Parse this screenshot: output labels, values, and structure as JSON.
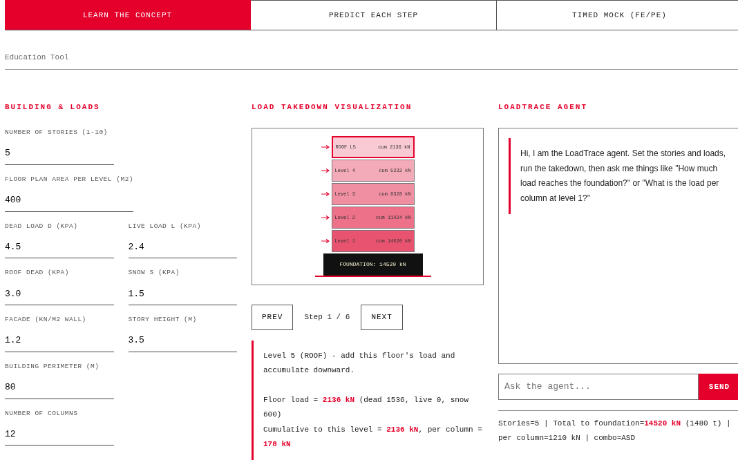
{
  "tabs": [
    {
      "label": "LEARN THE CONCEPT",
      "selected": true
    },
    {
      "label": "PREDICT EACH STEP",
      "selected": false
    },
    {
      "label": "TIMED MOCK (FE/PE)",
      "selected": false
    }
  ],
  "subtitle": "Education Tool",
  "inputs_panel": {
    "title": "BUILDING & LOADS",
    "rows": [
      [
        {
          "label": "NUMBER OF STORIES (1-10)",
          "value": "5"
        }
      ],
      [
        {
          "label": "FLOOR PLAN AREA PER LEVEL (M2)",
          "value": "400"
        }
      ],
      [
        {
          "label": "DEAD LOAD D (KPA)",
          "value": "4.5"
        },
        {
          "label": "LIVE LOAD L (KPA)",
          "value": "2.4"
        }
      ],
      [
        {
          "label": "ROOF DEAD (KPA)",
          "value": "3.0"
        },
        {
          "label": "SNOW S (KPA)",
          "value": "1.5"
        }
      ],
      [
        {
          "label": "FACADE (KN/M2 WALL)",
          "value": "1.2"
        },
        {
          "label": "STORY HEIGHT (M)",
          "value": "3.5"
        }
      ],
      [
        {
          "label": "BUILDING PERIMETER (M)",
          "value": "80"
        }
      ],
      [
        {
          "label": "NUMBER OF COLUMNS",
          "value": "12"
        }
      ]
    ]
  },
  "visualization": {
    "title": "LOAD TAKEDOWN VISUALIZATION",
    "floors": [
      {
        "name": "ROOF L5",
        "cumulative": "cum 2136 kN",
        "color": "#f9cad4",
        "selected": true
      },
      {
        "name": "Level 4",
        "cumulative": "cum 5232 kN",
        "color": "#f4abb9",
        "selected": false
      },
      {
        "name": "Level 3",
        "cumulative": "cum 8328 kN",
        "color": "#f08fa2",
        "selected": false
      },
      {
        "name": "Level 2",
        "cumulative": "cum 11424 kN",
        "color": "#ec7189",
        "selected": false
      },
      {
        "name": "Level 1",
        "cumulative": "cum 14520 kN",
        "color": "#e85470",
        "selected": false
      }
    ],
    "foundation": "FOUNDATION: 14520 kN",
    "prev_button": "PREV",
    "step": "Step 1 / 6",
    "next_button": "NEXT",
    "explanation": [
      "Level 5 (ROOF) - add this floor's load and accumulate downward.",
      "Floor load = **2136 kN** (dead 1536, live 0, snow 600)",
      "Cumulative to this level = **2136 kN**, per column = **178 kN**"
    ]
  },
  "agent": {
    "title": "LOADTRACE AGENT",
    "message": "Hi, I am the LoadTrace agent. Set the stories and loads, run the takedown, then ask me things like \"How much load reaches the foundation?\" or \"What is the load per column at level 1?\"",
    "placeholder": "Ask the agent...",
    "send_button": "SEND",
    "summary": "Stories=5 | Total to foundation=**14520 kN** (1480 t) | per column=1210 kN | combo=ASD"
  }
}
